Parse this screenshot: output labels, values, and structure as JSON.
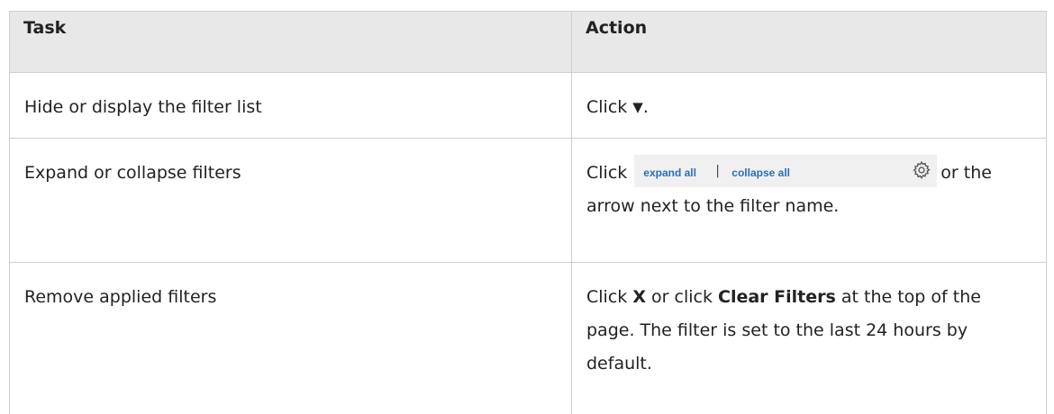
{
  "table": {
    "headers": [
      "Task",
      "Action"
    ],
    "rows": [
      {
        "task": "Hide or display the filter list",
        "action_prefix": "Click",
        "action_icon": "filter-icon",
        "action_suffix": "."
      },
      {
        "task": "Expand or collapse filters",
        "action_prefix": "Click",
        "strip": {
          "expand_label": "expand all",
          "separator": "|",
          "collapse_label": "collapse all",
          "icon": "gear-icon"
        },
        "action_suffix": "or the arrow next to the filter name."
      },
      {
        "task": "Remove applied filters",
        "action_part1": "Click",
        "action_bold1": "X",
        "action_part2": "or click",
        "action_bold2": "Clear Filters",
        "action_part3": "at the top of the page. The filter is set to the last 24 hours by default."
      }
    ]
  },
  "colors": {
    "header_bg": "#e8e8e8",
    "border": "#cfcfcf",
    "link": "#2a6fb8"
  }
}
